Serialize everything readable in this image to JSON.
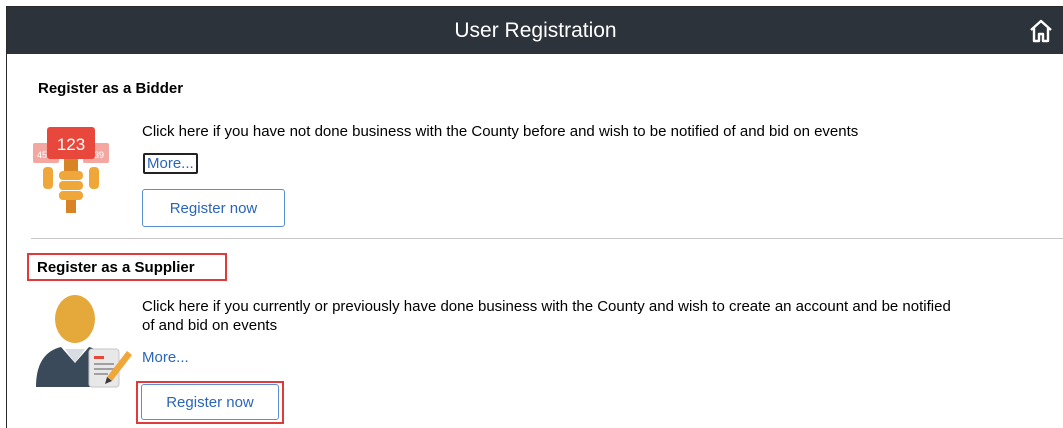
{
  "header": {
    "title": "User Registration",
    "home_icon": "home-icon"
  },
  "bidder": {
    "title": "Register as a Bidder",
    "badge_number": "123",
    "description": "Click here if you have not done business with the County before and wish to be notified of and bid on events",
    "more_label": "More...",
    "register_label": "Register now"
  },
  "supplier": {
    "title": "Register as a Supplier",
    "description_line1": "Click here if you currently or previously have done business with the County and wish to create an account and be notified",
    "description_line2": "of and bid on events",
    "more_label": "More...",
    "register_label": "Register now"
  },
  "colors": {
    "header_bg": "#2d333b",
    "link": "#2a66b7",
    "highlight": "#e03a3a"
  }
}
